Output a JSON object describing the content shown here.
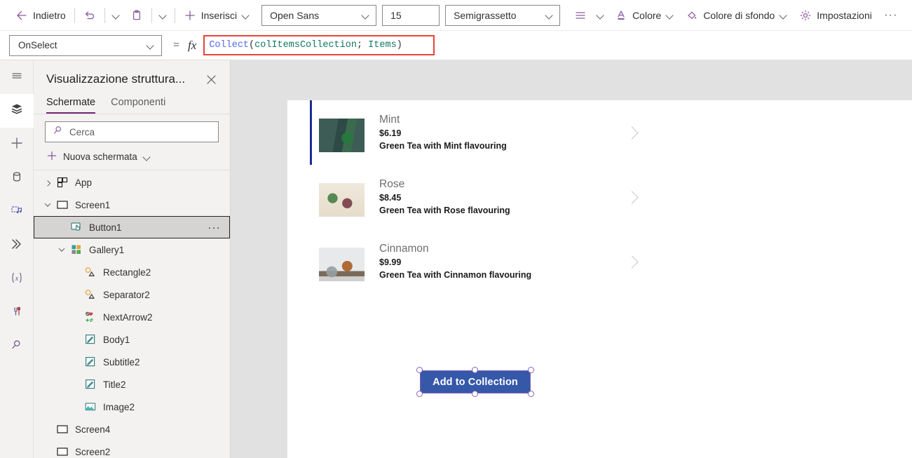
{
  "toolbar": {
    "back_label": "Indietro",
    "undo_icon": "undo-icon",
    "paste_icon": "paste-icon",
    "insert_label": "Inserisci",
    "font_family_value": "Open Sans",
    "font_size_value": "15",
    "font_weight_value": "Semigrassetto",
    "align_icon": "align-icon",
    "color_label": "Colore",
    "background_color_label": "Colore di sfondo",
    "settings_label": "Impostazioni",
    "overflow_label": "···"
  },
  "formula_bar": {
    "property_value": "OnSelect",
    "equals": "=",
    "fx": "fx",
    "formula_tokens": [
      {
        "text": "Collect",
        "type": "fn"
      },
      {
        "text": "(",
        "type": "punct"
      },
      {
        "text": "colItemsCollection",
        "type": "ident"
      },
      {
        "text": "; ",
        "type": "punct"
      },
      {
        "text": "Items",
        "type": "ident"
      },
      {
        "text": ")",
        "type": "punct"
      }
    ],
    "formula_text": "Collect(colItemsCollection; Items)",
    "error_border_color": "#e8433a"
  },
  "rail": {
    "items": [
      {
        "icon": "hamburger-menu-icon",
        "name": "menu",
        "active": false
      },
      {
        "icon": "layers-tree-view-icon",
        "name": "tree-view",
        "active": true
      },
      {
        "icon": "plus-insert-icon",
        "name": "insert",
        "active": false
      },
      {
        "icon": "database-data-icon",
        "name": "data",
        "active": false
      },
      {
        "icon": "media-icon",
        "name": "media",
        "active": false
      },
      {
        "icon": "power-automate-flow-icon",
        "name": "power-automate",
        "active": false
      },
      {
        "icon": "variables-x-icon",
        "name": "variables",
        "active": false
      },
      {
        "icon": "tools-icon",
        "name": "tools",
        "active": false
      },
      {
        "icon": "search-magnifier-icon",
        "name": "search",
        "active": false
      }
    ]
  },
  "tree_panel": {
    "title": "Visualizzazione struttura...",
    "close_icon": "close-icon",
    "tabs": [
      {
        "label": "Schermate",
        "selected": true
      },
      {
        "label": "Componenti",
        "selected": false
      }
    ],
    "search_placeholder": "Cerca",
    "search_value": "",
    "search_icon": "search-icon",
    "new_screen_label": "Nuova schermata",
    "new_screen_icon": "plus-icon",
    "items": [
      {
        "label": "App",
        "icon": "app-grid-icon",
        "indent": 0,
        "twist": "right",
        "selected": false,
        "more": false
      },
      {
        "label": "Screen1",
        "icon": "screen-icon",
        "indent": 0,
        "twist": "down",
        "selected": false,
        "more": false
      },
      {
        "label": "Button1",
        "icon": "button-icon",
        "indent": 1,
        "twist": "none",
        "selected": true,
        "more": true
      },
      {
        "label": "Gallery1",
        "icon": "gallery-icon",
        "indent": 1,
        "twist": "down",
        "selected": false,
        "more": false
      },
      {
        "label": "Rectangle2",
        "icon": "shape-icon",
        "indent": 2,
        "twist": "none",
        "selected": false,
        "more": false
      },
      {
        "label": "Separator2",
        "icon": "shape-icon",
        "indent": 2,
        "twist": "none",
        "selected": false,
        "more": false
      },
      {
        "label": "NextArrow2",
        "icon": "next-arrow-icon",
        "indent": 2,
        "twist": "none",
        "selected": false,
        "more": false
      },
      {
        "label": "Body1",
        "icon": "label-text-icon",
        "indent": 2,
        "twist": "none",
        "selected": false,
        "more": false
      },
      {
        "label": "Subtitle2",
        "icon": "label-text-icon",
        "indent": 2,
        "twist": "none",
        "selected": false,
        "more": false
      },
      {
        "label": "Title2",
        "icon": "label-text-icon",
        "indent": 2,
        "twist": "none",
        "selected": false,
        "more": false
      },
      {
        "label": "Image2",
        "icon": "image-icon",
        "indent": 2,
        "twist": "none",
        "selected": false,
        "more": false
      },
      {
        "label": "Screen4",
        "icon": "screen-icon",
        "indent": 0,
        "twist": "none",
        "selected": false,
        "more": false
      },
      {
        "label": "Screen2",
        "icon": "screen-icon",
        "indent": 0,
        "twist": "none",
        "selected": false,
        "more": false
      }
    ]
  },
  "canvas": {
    "gallery": {
      "selected_index": 0,
      "selection_bar_color": "#1c2d8f",
      "items": [
        {
          "title": "Mint",
          "price": "$6.19",
          "description": "Green Tea with Mint flavouring",
          "thumb": "mint-tea-can-photo"
        },
        {
          "title": "Rose",
          "price": "$8.45",
          "description": "Green Tea with Rose flavouring",
          "thumb": "rose-tea-can-photo"
        },
        {
          "title": "Cinnamon",
          "price": "$9.99",
          "description": "Green Tea with Cinnamon flavouring",
          "thumb": "cinnamon-tea-can-photo"
        }
      ],
      "next_arrow_icon": "chevron-right-icon"
    },
    "selected_control": {
      "label": "Add to Collection",
      "fill_color": "#3658a9",
      "text_color": "#ffffff",
      "selection_border_color": "#8764b8"
    }
  }
}
